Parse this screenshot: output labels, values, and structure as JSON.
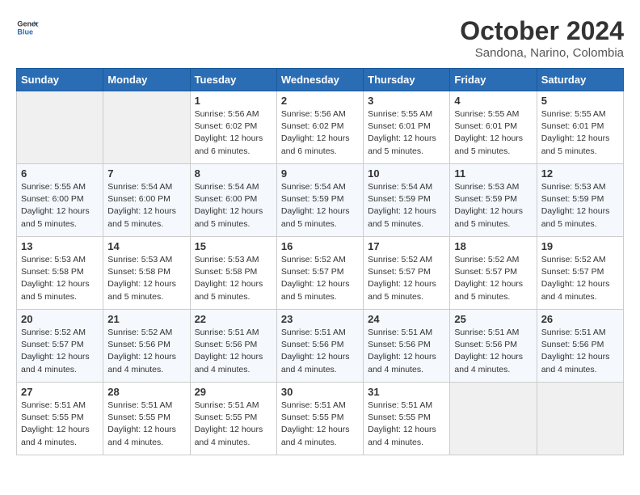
{
  "header": {
    "logo_general": "General",
    "logo_blue": "Blue",
    "title": "October 2024",
    "subtitle": "Sandona, Narino, Colombia"
  },
  "days_of_week": [
    "Sunday",
    "Monday",
    "Tuesday",
    "Wednesday",
    "Thursday",
    "Friday",
    "Saturday"
  ],
  "weeks": [
    [
      {
        "day": "",
        "empty": true
      },
      {
        "day": "",
        "empty": true
      },
      {
        "day": "1",
        "sunrise": "Sunrise: 5:56 AM",
        "sunset": "Sunset: 6:02 PM",
        "daylight": "Daylight: 12 hours and 6 minutes."
      },
      {
        "day": "2",
        "sunrise": "Sunrise: 5:56 AM",
        "sunset": "Sunset: 6:02 PM",
        "daylight": "Daylight: 12 hours and 6 minutes."
      },
      {
        "day": "3",
        "sunrise": "Sunrise: 5:55 AM",
        "sunset": "Sunset: 6:01 PM",
        "daylight": "Daylight: 12 hours and 5 minutes."
      },
      {
        "day": "4",
        "sunrise": "Sunrise: 5:55 AM",
        "sunset": "Sunset: 6:01 PM",
        "daylight": "Daylight: 12 hours and 5 minutes."
      },
      {
        "day": "5",
        "sunrise": "Sunrise: 5:55 AM",
        "sunset": "Sunset: 6:01 PM",
        "daylight": "Daylight: 12 hours and 5 minutes."
      }
    ],
    [
      {
        "day": "6",
        "sunrise": "Sunrise: 5:55 AM",
        "sunset": "Sunset: 6:00 PM",
        "daylight": "Daylight: 12 hours and 5 minutes."
      },
      {
        "day": "7",
        "sunrise": "Sunrise: 5:54 AM",
        "sunset": "Sunset: 6:00 PM",
        "daylight": "Daylight: 12 hours and 5 minutes."
      },
      {
        "day": "8",
        "sunrise": "Sunrise: 5:54 AM",
        "sunset": "Sunset: 6:00 PM",
        "daylight": "Daylight: 12 hours and 5 minutes."
      },
      {
        "day": "9",
        "sunrise": "Sunrise: 5:54 AM",
        "sunset": "Sunset: 5:59 PM",
        "daylight": "Daylight: 12 hours and 5 minutes."
      },
      {
        "day": "10",
        "sunrise": "Sunrise: 5:54 AM",
        "sunset": "Sunset: 5:59 PM",
        "daylight": "Daylight: 12 hours and 5 minutes."
      },
      {
        "day": "11",
        "sunrise": "Sunrise: 5:53 AM",
        "sunset": "Sunset: 5:59 PM",
        "daylight": "Daylight: 12 hours and 5 minutes."
      },
      {
        "day": "12",
        "sunrise": "Sunrise: 5:53 AM",
        "sunset": "Sunset: 5:59 PM",
        "daylight": "Daylight: 12 hours and 5 minutes."
      }
    ],
    [
      {
        "day": "13",
        "sunrise": "Sunrise: 5:53 AM",
        "sunset": "Sunset: 5:58 PM",
        "daylight": "Daylight: 12 hours and 5 minutes."
      },
      {
        "day": "14",
        "sunrise": "Sunrise: 5:53 AM",
        "sunset": "Sunset: 5:58 PM",
        "daylight": "Daylight: 12 hours and 5 minutes."
      },
      {
        "day": "15",
        "sunrise": "Sunrise: 5:53 AM",
        "sunset": "Sunset: 5:58 PM",
        "daylight": "Daylight: 12 hours and 5 minutes."
      },
      {
        "day": "16",
        "sunrise": "Sunrise: 5:52 AM",
        "sunset": "Sunset: 5:57 PM",
        "daylight": "Daylight: 12 hours and 5 minutes."
      },
      {
        "day": "17",
        "sunrise": "Sunrise: 5:52 AM",
        "sunset": "Sunset: 5:57 PM",
        "daylight": "Daylight: 12 hours and 5 minutes."
      },
      {
        "day": "18",
        "sunrise": "Sunrise: 5:52 AM",
        "sunset": "Sunset: 5:57 PM",
        "daylight": "Daylight: 12 hours and 5 minutes."
      },
      {
        "day": "19",
        "sunrise": "Sunrise: 5:52 AM",
        "sunset": "Sunset: 5:57 PM",
        "daylight": "Daylight: 12 hours and 4 minutes."
      }
    ],
    [
      {
        "day": "20",
        "sunrise": "Sunrise: 5:52 AM",
        "sunset": "Sunset: 5:57 PM",
        "daylight": "Daylight: 12 hours and 4 minutes."
      },
      {
        "day": "21",
        "sunrise": "Sunrise: 5:52 AM",
        "sunset": "Sunset: 5:56 PM",
        "daylight": "Daylight: 12 hours and 4 minutes."
      },
      {
        "day": "22",
        "sunrise": "Sunrise: 5:51 AM",
        "sunset": "Sunset: 5:56 PM",
        "daylight": "Daylight: 12 hours and 4 minutes."
      },
      {
        "day": "23",
        "sunrise": "Sunrise: 5:51 AM",
        "sunset": "Sunset: 5:56 PM",
        "daylight": "Daylight: 12 hours and 4 minutes."
      },
      {
        "day": "24",
        "sunrise": "Sunrise: 5:51 AM",
        "sunset": "Sunset: 5:56 PM",
        "daylight": "Daylight: 12 hours and 4 minutes."
      },
      {
        "day": "25",
        "sunrise": "Sunrise: 5:51 AM",
        "sunset": "Sunset: 5:56 PM",
        "daylight": "Daylight: 12 hours and 4 minutes."
      },
      {
        "day": "26",
        "sunrise": "Sunrise: 5:51 AM",
        "sunset": "Sunset: 5:56 PM",
        "daylight": "Daylight: 12 hours and 4 minutes."
      }
    ],
    [
      {
        "day": "27",
        "sunrise": "Sunrise: 5:51 AM",
        "sunset": "Sunset: 5:55 PM",
        "daylight": "Daylight: 12 hours and 4 minutes."
      },
      {
        "day": "28",
        "sunrise": "Sunrise: 5:51 AM",
        "sunset": "Sunset: 5:55 PM",
        "daylight": "Daylight: 12 hours and 4 minutes."
      },
      {
        "day": "29",
        "sunrise": "Sunrise: 5:51 AM",
        "sunset": "Sunset: 5:55 PM",
        "daylight": "Daylight: 12 hours and 4 minutes."
      },
      {
        "day": "30",
        "sunrise": "Sunrise: 5:51 AM",
        "sunset": "Sunset: 5:55 PM",
        "daylight": "Daylight: 12 hours and 4 minutes."
      },
      {
        "day": "31",
        "sunrise": "Sunrise: 5:51 AM",
        "sunset": "Sunset: 5:55 PM",
        "daylight": "Daylight: 12 hours and 4 minutes."
      },
      {
        "day": "",
        "empty": true
      },
      {
        "day": "",
        "empty": true
      }
    ]
  ]
}
